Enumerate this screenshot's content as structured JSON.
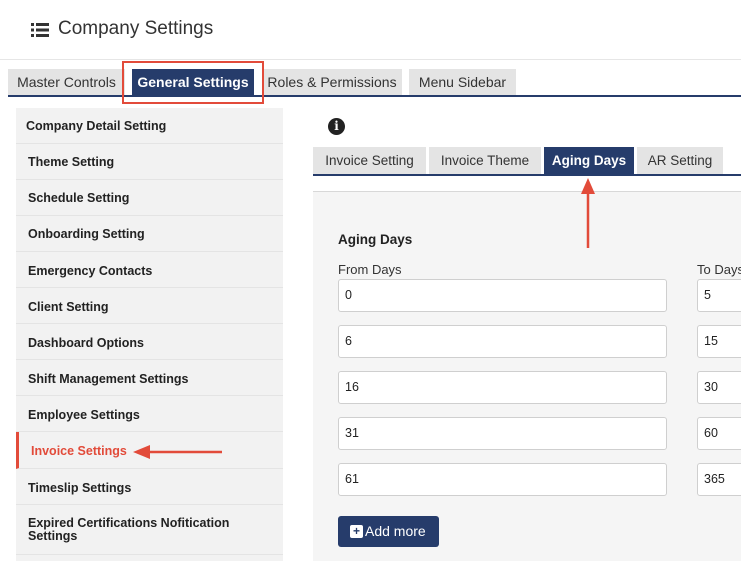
{
  "header": {
    "title": "Company Settings"
  },
  "main_tabs": [
    {
      "label": "Master Controls",
      "active": false
    },
    {
      "label": "General Settings",
      "active": true
    },
    {
      "label": "Roles & Permissions",
      "active": false
    },
    {
      "label": "Menu Sidebar",
      "active": false
    }
  ],
  "sidebar": {
    "items": [
      {
        "label": "Company Detail Setting"
      },
      {
        "label": "Theme Setting"
      },
      {
        "label": "Schedule Setting"
      },
      {
        "label": "Onboarding Setting"
      },
      {
        "label": "Emergency Contacts"
      },
      {
        "label": "Client Setting"
      },
      {
        "label": "Dashboard Options"
      },
      {
        "label": "Shift Management Settings"
      },
      {
        "label": "Employee Settings"
      },
      {
        "label": "Invoice Settings",
        "active": true
      },
      {
        "label": "Timeslip Settings"
      },
      {
        "label": "Expired Certifications Nofitication Settings"
      }
    ]
  },
  "sub_tabs": [
    {
      "label": "Invoice Setting",
      "active": false
    },
    {
      "label": "Invoice Theme",
      "active": false
    },
    {
      "label": "Aging Days",
      "active": true
    },
    {
      "label": "AR Setting",
      "active": false
    }
  ],
  "aging": {
    "title": "Aging Days",
    "from_label": "From Days",
    "to_label": "To Days",
    "rows": [
      {
        "from": "0",
        "to": "5"
      },
      {
        "from": "6",
        "to": "15"
      },
      {
        "from": "16",
        "to": "30"
      },
      {
        "from": "31",
        "to": "60"
      },
      {
        "from": "61",
        "to": "365"
      }
    ],
    "add_label": "Add more"
  },
  "colors": {
    "accent": "#263c6b",
    "highlight": "#e24b3a"
  }
}
